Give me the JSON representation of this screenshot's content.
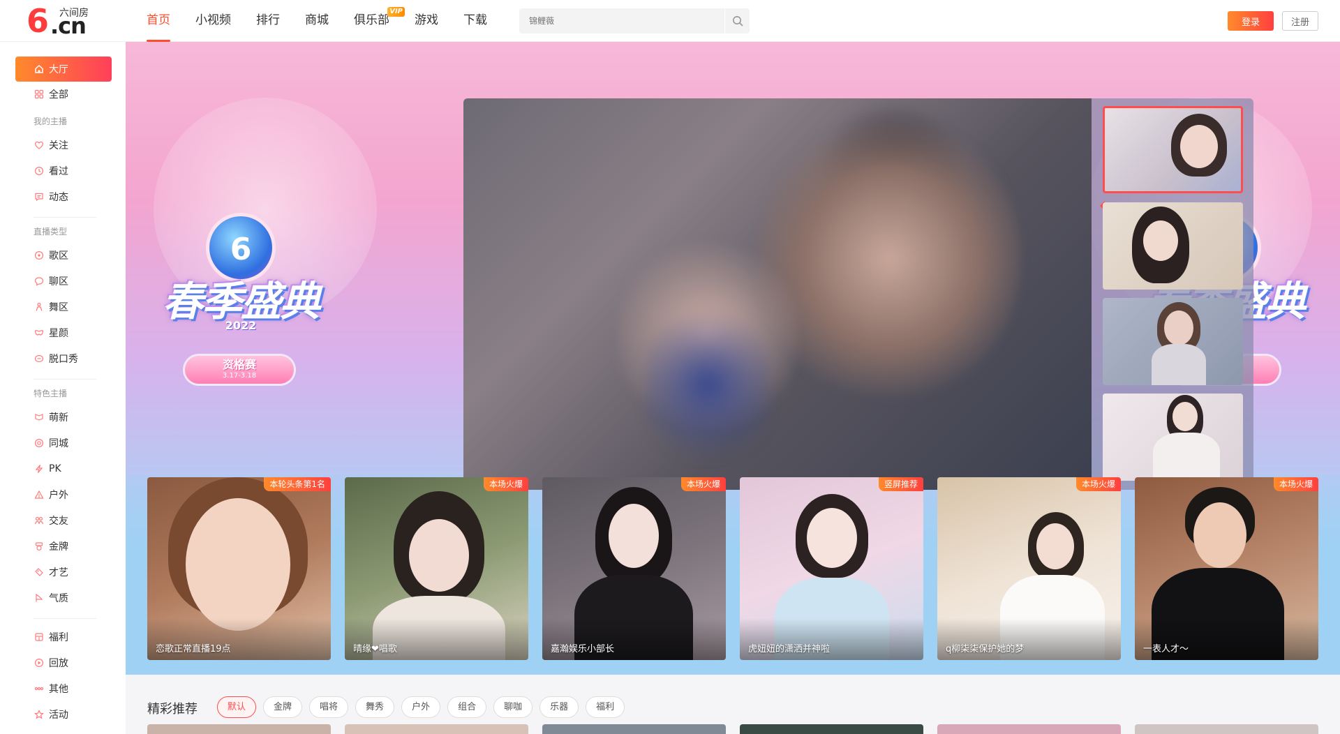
{
  "header": {
    "logo_text": "6",
    "logo_cn": ".cn",
    "logo_sub": "六间房",
    "nav": [
      {
        "label": "首页",
        "active": true
      },
      {
        "label": "小视频"
      },
      {
        "label": "排行"
      },
      {
        "label": "商城"
      },
      {
        "label": "俱乐部",
        "badge": "VIP"
      },
      {
        "label": "游戏"
      },
      {
        "label": "下载"
      }
    ],
    "search_placeholder": "锦鲤薇",
    "login_label": "登录",
    "register_label": "注册"
  },
  "sidebar": {
    "items": [
      {
        "label": "大厅",
        "icon": "home-icon",
        "active": true
      },
      {
        "label": "全部",
        "icon": "grid-icon"
      }
    ],
    "groups": [
      {
        "title": "我的主播",
        "items": [
          {
            "label": "关注",
            "icon": "heart-icon"
          },
          {
            "label": "看过",
            "icon": "clock-icon"
          },
          {
            "label": "动态",
            "icon": "message-icon"
          }
        ]
      },
      {
        "title": "直播类型",
        "items": [
          {
            "label": "歌区",
            "icon": "music-icon"
          },
          {
            "label": "聊区",
            "icon": "chat-icon"
          },
          {
            "label": "舞区",
            "icon": "dance-icon"
          },
          {
            "label": "星颜",
            "icon": "mask-icon"
          },
          {
            "label": "脱口秀",
            "icon": "mic-icon"
          }
        ]
      },
      {
        "title": "特色主播",
        "items": [
          {
            "label": "萌新",
            "icon": "sprout-icon"
          },
          {
            "label": "同城",
            "icon": "location-icon"
          },
          {
            "label": "PK",
            "icon": "lightning-icon"
          },
          {
            "label": "户外",
            "icon": "tent-icon"
          },
          {
            "label": "交友",
            "icon": "friends-icon"
          },
          {
            "label": "金牌",
            "icon": "medal-icon"
          },
          {
            "label": "才艺",
            "icon": "palette-icon"
          },
          {
            "label": "气质",
            "icon": "flag-icon"
          }
        ]
      },
      {
        "title": "",
        "items": [
          {
            "label": "福利",
            "icon": "gift-icon"
          },
          {
            "label": "回放",
            "icon": "replay-icon"
          },
          {
            "label": "其他",
            "icon": "more-icon"
          },
          {
            "label": "活动",
            "icon": "star-icon"
          }
        ]
      }
    ]
  },
  "hero": {
    "emblem_title": "春季盛典",
    "emblem_year": "2022",
    "emblem_pill_main": "资格赛",
    "emblem_pill_date": "3.17-3.18",
    "emblem_logo": "6"
  },
  "recommend": [
    {
      "badge": "本轮头条第1名",
      "name": "恋歌正常直播19点"
    },
    {
      "badge": "本场火爆",
      "name": "晴缘❤唱歌"
    },
    {
      "badge": "本场火爆",
      "name": "嘉瀚娱乐小部长"
    },
    {
      "badge": "竖屏推荐",
      "name": "虎妞妞的潇洒并神啦"
    },
    {
      "badge": "本场火爆",
      "name": "q柳柒柒保护她的梦"
    },
    {
      "badge": "本场火爆",
      "name": "一表人才～"
    }
  ],
  "featured": {
    "title": "精彩推荐",
    "tags": [
      {
        "label": "默认",
        "active": true
      },
      {
        "label": "金牌"
      },
      {
        "label": "唱将"
      },
      {
        "label": "舞秀"
      },
      {
        "label": "户外"
      },
      {
        "label": "组合"
      },
      {
        "label": "聊咖"
      },
      {
        "label": "乐器"
      },
      {
        "label": "福利"
      }
    ]
  },
  "colors": {
    "accent": "#ff4d2d",
    "gradient_start": "#ff8a2b",
    "gradient_end": "#ff3f3f"
  }
}
